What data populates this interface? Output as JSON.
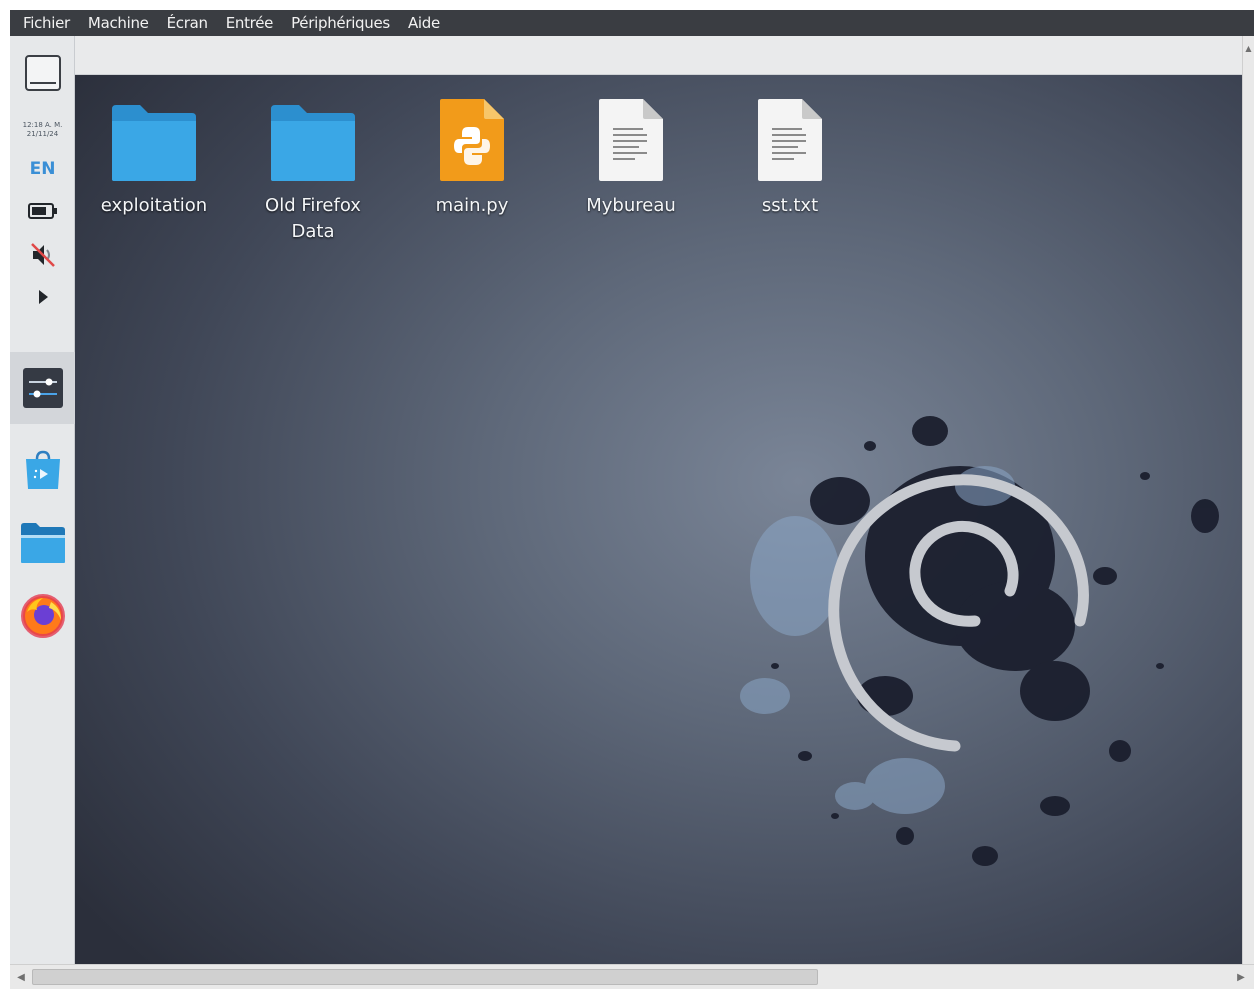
{
  "menubar": {
    "items": [
      "Fichier",
      "Machine",
      "Écran",
      "Entrée",
      "Périphériques",
      "Aide"
    ]
  },
  "dock": {
    "clock_time": "12:18 A. M.",
    "clock_date": "21/11/24",
    "keyboard_layout": "EN",
    "items": [
      {
        "name": "show-desktop-icon"
      },
      {
        "name": "battery-icon"
      },
      {
        "name": "volume-muted-icon"
      },
      {
        "name": "expand-arrow-icon"
      },
      {
        "name": "settings-sliders-icon"
      },
      {
        "name": "software-store-icon"
      },
      {
        "name": "file-manager-icon"
      },
      {
        "name": "firefox-icon"
      }
    ]
  },
  "desktop": {
    "icons": [
      {
        "label": "exploitation",
        "type": "folder"
      },
      {
        "label": "Old Firefox Data",
        "type": "folder"
      },
      {
        "label": "main.py",
        "type": "python"
      },
      {
        "label": "Mybureau",
        "type": "document"
      },
      {
        "label": "sst.txt",
        "type": "document"
      }
    ]
  },
  "colors": {
    "folder": "#3aa7e6",
    "python": "#f29b1a",
    "accent": "#3a8fd6",
    "menubar": "#3a3d42"
  }
}
